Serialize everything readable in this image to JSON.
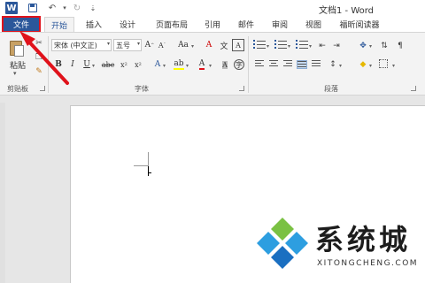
{
  "window": {
    "title": "文档1 - Word"
  },
  "quick_access": {
    "logo_letter": "W"
  },
  "tabs": [
    {
      "label": "文件"
    },
    {
      "label": "开始"
    },
    {
      "label": "插入"
    },
    {
      "label": "设计"
    },
    {
      "label": "页面布局"
    },
    {
      "label": "引用"
    },
    {
      "label": "邮件"
    },
    {
      "label": "审阅"
    },
    {
      "label": "视图"
    },
    {
      "label": "福昕阅读器"
    }
  ],
  "ribbon": {
    "clipboard": {
      "paste_label": "粘贴",
      "group_label": "剪贴板"
    },
    "font": {
      "font_name": "宋体 (中文正)",
      "font_size": "五号",
      "group_label": "字体"
    },
    "paragraph": {
      "group_label": "段落"
    }
  },
  "watermark": {
    "brand": "系统城",
    "domain": "XITONGCHENG.COM"
  },
  "colors": {
    "accent": "#2b579a",
    "highlight_border": "#e0121b",
    "arrow": "#e0121b"
  }
}
